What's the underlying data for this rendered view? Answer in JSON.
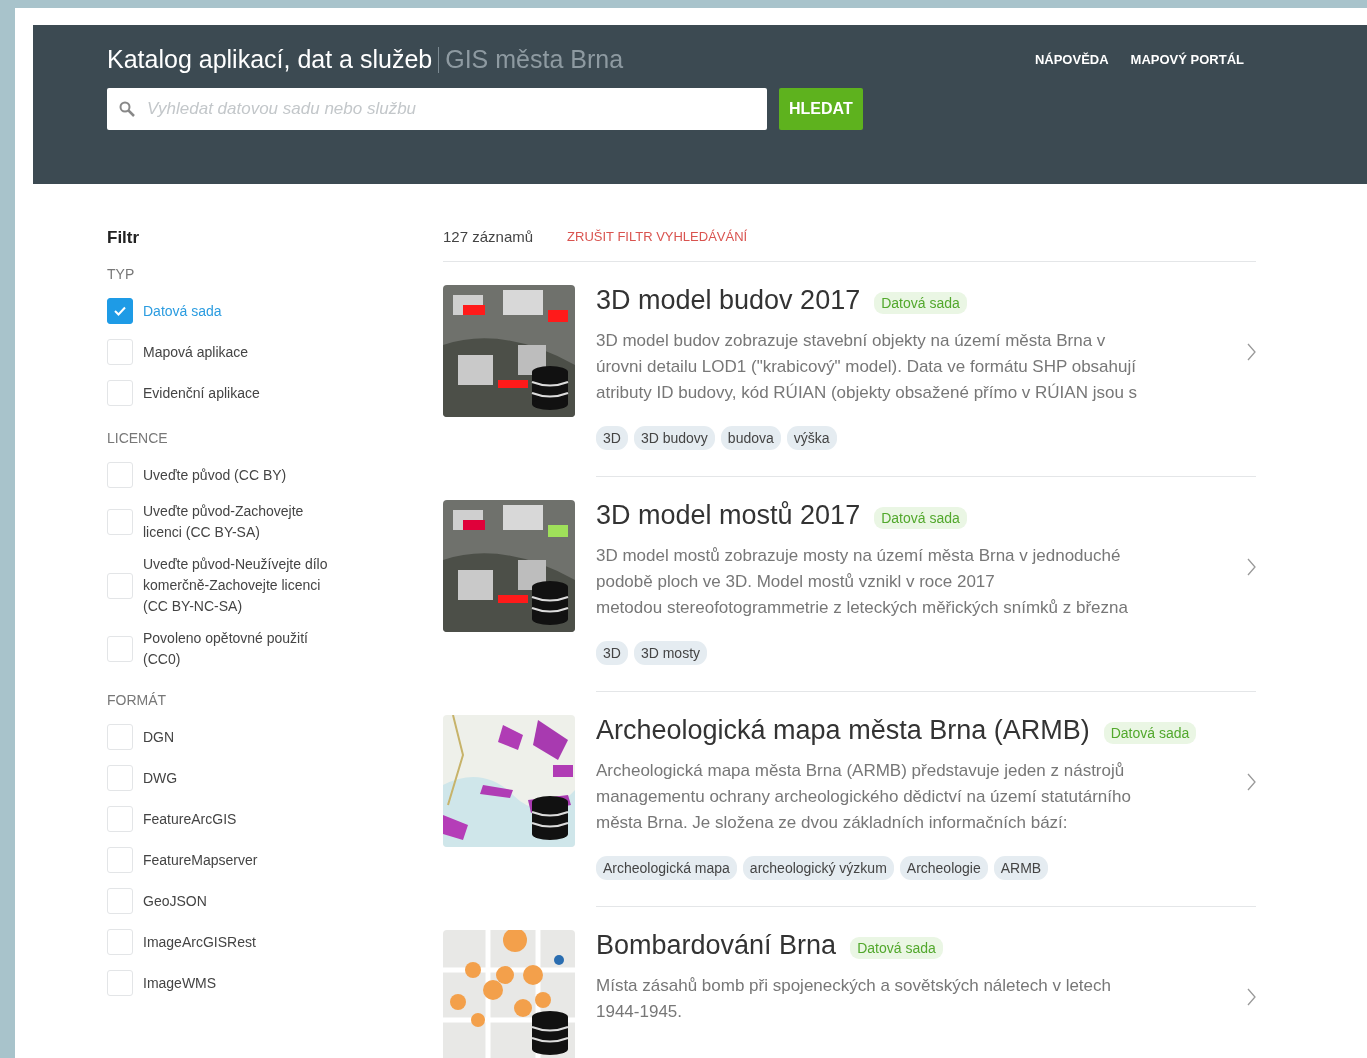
{
  "header": {
    "title": "Katalog aplikací, dat a služeb",
    "subtitle": "GIS města Brna",
    "nav": [
      "NÁPOVĚDA",
      "MAPOVÝ PORTÁL"
    ],
    "search": {
      "placeholder": "Vyhledat datovou sadu nebo službu"
    },
    "search_button": "HLEDAT"
  },
  "filter": {
    "title": "Filtr",
    "groups": [
      {
        "title": "TYP",
        "options": [
          {
            "label": "Datová sada",
            "checked": true
          },
          {
            "label": "Mapová aplikace",
            "checked": false
          },
          {
            "label": "Evidenční aplikace",
            "checked": false
          }
        ]
      },
      {
        "title": "LICENCE",
        "options": [
          {
            "label": "Uveďte původ (CC BY)",
            "checked": false
          },
          {
            "label": "Uveďte původ-Zachovejte licenci (CC BY-SA)",
            "checked": false
          },
          {
            "label": "Uveďte původ-Neužívejte dílo komerčně-Zachovejte licenci (CC BY-NC-SA)",
            "checked": false
          },
          {
            "label": "Povoleno opětovné použití (CC0)",
            "checked": false
          }
        ]
      },
      {
        "title": "FORMÁT",
        "options": [
          {
            "label": "DGN",
            "checked": false
          },
          {
            "label": "DWG",
            "checked": false
          },
          {
            "label": "FeatureArcGIS",
            "checked": false
          },
          {
            "label": "FeatureMapserver",
            "checked": false
          },
          {
            "label": "GeoJSON",
            "checked": false
          },
          {
            "label": "ImageArcGISRest",
            "checked": false
          },
          {
            "label": "ImageWMS",
            "checked": false
          }
        ]
      }
    ]
  },
  "results": {
    "count": "127 záznamů",
    "clear_filter": "ZRUŠIT FILTR VYHLEDÁVÁNÍ",
    "items": [
      {
        "title": "3D model budov 2017",
        "badge": "Datová sada",
        "description_lines": [
          "3D model budov zobrazuje stavební objekty na území města Brna v",
          "úrovni detailu LOD1 (\"krabicový\" model). Data ve formátu SHP obsahují",
          "atributy ID budovy, kód RÚIAN (objekty obsažené přímo v RÚIAN jsou s"
        ],
        "tags": [
          "3D",
          "3D budovy",
          "budova",
          "výška"
        ]
      },
      {
        "title": "3D model mostů 2017",
        "badge": "Datová sada",
        "description_lines": [
          "3D model mostů zobrazuje mosty na území města Brna v jednoduché",
          "podobě ploch ve 3D. Model mostů vznikl v roce 2017",
          "metodou stereofotogrammetrie z leteckých měřických snímků z března"
        ],
        "tags": [
          "3D",
          "3D mosty"
        ]
      },
      {
        "title": "Archeologická mapa města Brna (ARMB)",
        "badge": "Datová sada",
        "description_lines": [
          "Archeologická mapa města Brna (ARMB) představuje jeden z nástrojů",
          "managementu ochrany archeologického dědictví na území statutárního",
          "města Brna. Je složena ze dvou základních informačních bází:"
        ],
        "tags": [
          "Archeologická mapa",
          "archeologický výzkum",
          "Archeologie",
          "ARMB"
        ]
      },
      {
        "title": "Bombardování Brna",
        "badge": "Datová sada",
        "description_lines": [
          "Místa zásahů bomb při spojeneckých a sovětských náletech v letech",
          "1944-1945."
        ]
      }
    ]
  }
}
